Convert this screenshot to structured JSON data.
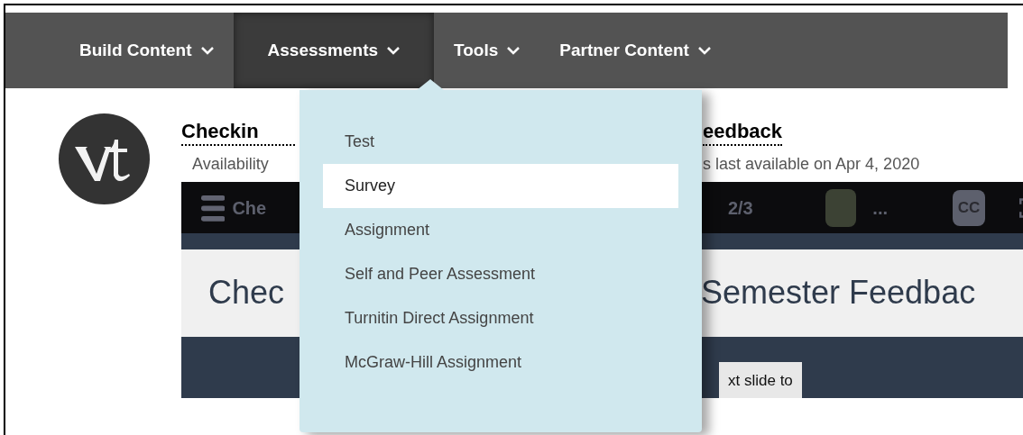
{
  "nav_tabs": [
    {
      "label": "Build Content",
      "selected": false
    },
    {
      "label": "Assessments",
      "selected": true
    },
    {
      "label": "Tools",
      "selected": false
    },
    {
      "label": "Partner Content",
      "selected": false
    }
  ],
  "dropdown": {
    "items": [
      {
        "label": "Test",
        "selected": false
      },
      {
        "label": "Survey",
        "selected": true
      },
      {
        "label": "Assignment",
        "selected": false
      },
      {
        "label": "Self and Peer Assessment",
        "selected": false
      },
      {
        "label": "Turnitin Direct Assignment",
        "selected": false
      },
      {
        "label": "McGraw-Hill Assignment",
        "selected": false
      }
    ]
  },
  "content_item": {
    "title_left": "Checkin",
    "title_right": "eedback",
    "availability_left": "Availability",
    "availability_right": "s last available on Apr 4, 2020"
  },
  "video": {
    "bar_title": "Che",
    "slide_counter": "2/3",
    "presenter_name": "...",
    "cc_label": "CC",
    "slide_title_left": "Chec",
    "slide_title_right": "Semester Feedbac",
    "slide_note": "xt slide to"
  }
}
